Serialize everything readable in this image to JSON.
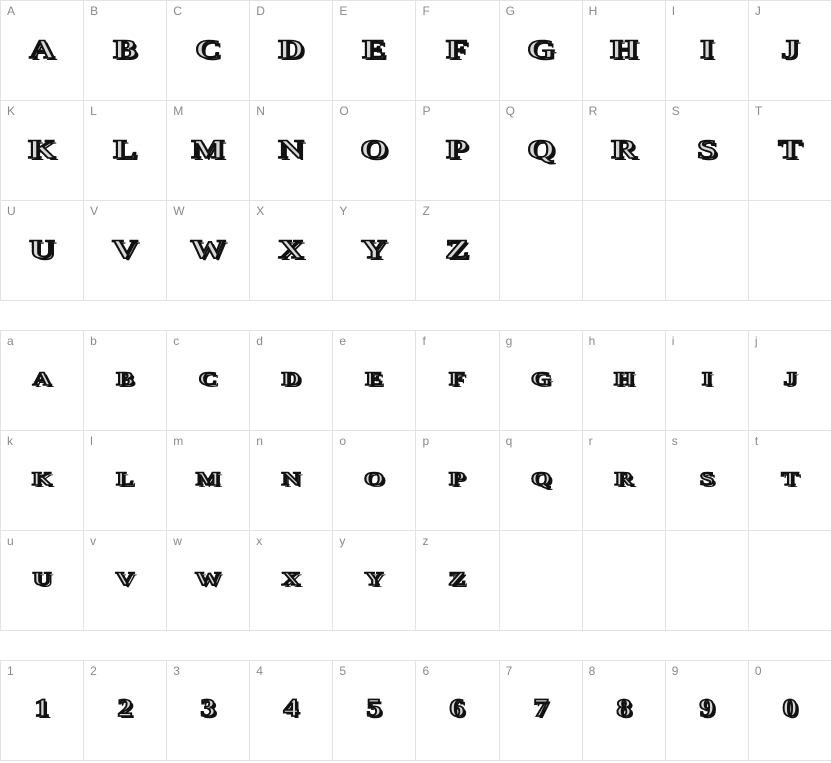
{
  "sections": [
    {
      "id": "uppercase",
      "chars": [
        "A",
        "B",
        "C",
        "D",
        "E",
        "F",
        "G",
        "H",
        "I",
        "J",
        "K",
        "L",
        "M",
        "N",
        "O",
        "P",
        "Q",
        "R",
        "S",
        "T",
        "U",
        "V",
        "W",
        "X",
        "Y",
        "Z"
      ],
      "cells": 30
    },
    {
      "id": "lowercase",
      "chars": [
        "a",
        "b",
        "c",
        "d",
        "e",
        "f",
        "g",
        "h",
        "i",
        "j",
        "k",
        "l",
        "m",
        "n",
        "o",
        "p",
        "q",
        "r",
        "s",
        "t",
        "u",
        "v",
        "w",
        "x",
        "y",
        "z"
      ],
      "cells": 30
    },
    {
      "id": "digits",
      "chars": [
        "1",
        "2",
        "3",
        "4",
        "5",
        "6",
        "7",
        "8",
        "9",
        "0"
      ],
      "cells": 10
    }
  ]
}
